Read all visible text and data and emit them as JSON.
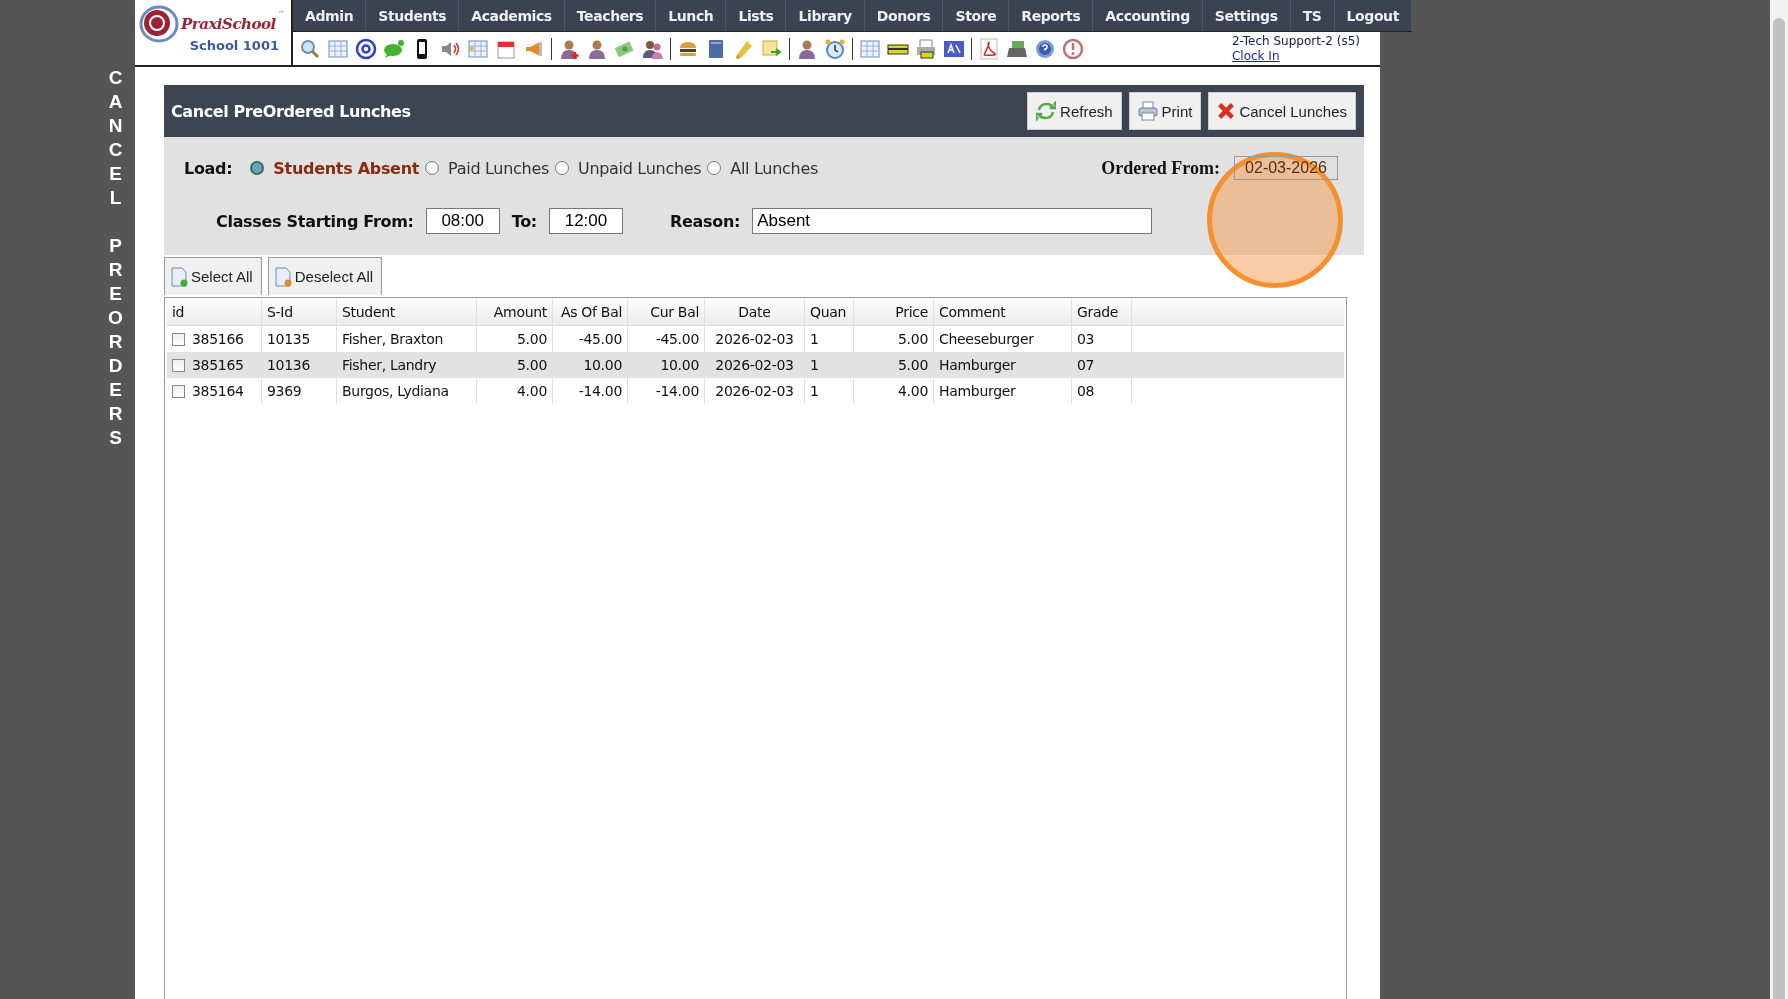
{
  "side_title": "CANCEL PREORDERS",
  "logo": {
    "brand": "PraxiSchool",
    "trademark": "™",
    "school": "School 1001"
  },
  "nav": [
    "Admin",
    "Students",
    "Academics",
    "Teachers",
    "Lunch",
    "Lists",
    "Library",
    "Donors",
    "Store",
    "Reports",
    "Accounting",
    "Settings",
    "TS",
    "Logout"
  ],
  "user": {
    "name": "2-Tech Support-2 (s5)",
    "link": "Clock In"
  },
  "panel": {
    "title": "Cancel PreOrdered Lunches",
    "buttons": [
      {
        "label": "Refresh",
        "kind": "refresh"
      },
      {
        "label": "Print",
        "kind": "print"
      },
      {
        "label": "Cancel Lunches",
        "kind": "cancel"
      }
    ]
  },
  "load": {
    "label": "Load:",
    "options": [
      {
        "label": "Students Absent",
        "selected": true
      },
      {
        "label": "Paid Lunches",
        "selected": false
      },
      {
        "label": "Unpaid Lunches",
        "selected": false
      },
      {
        "label": "All Lunches",
        "selected": false
      }
    ]
  },
  "ordered_from": {
    "label": "Ordered From:",
    "value": "02-03-2026"
  },
  "classes_from": {
    "label": "Classes Starting From:",
    "value": "08:00"
  },
  "classes_to": {
    "label": "To:",
    "value": "12:00"
  },
  "reason": {
    "label": "Reason:",
    "value": "Absent"
  },
  "list_buttons": [
    {
      "label": "Select All",
      "kind": "select"
    },
    {
      "label": "Deselect All",
      "kind": "deselect"
    }
  ],
  "table": {
    "columns": [
      "id",
      "S-Id",
      "Student",
      "Amount",
      "As Of Bal",
      "Cur Bal",
      "Date",
      "Quan",
      "Price",
      "Comment",
      "Grade"
    ],
    "rows": [
      {
        "checked": false,
        "selected": false,
        "cells": [
          "385166",
          "10135",
          "Fisher, Braxton",
          "5.00",
          "-45.00",
          "-45.00",
          "2026-02-03",
          "1",
          "5.00",
          "Cheeseburger",
          "03"
        ]
      },
      {
        "checked": false,
        "selected": true,
        "cells": [
          "385165",
          "10136",
          "Fisher, Landry",
          "5.00",
          "10.00",
          "10.00",
          "2026-02-03",
          "1",
          "5.00",
          "Hamburger",
          "07"
        ]
      },
      {
        "checked": false,
        "selected": false,
        "cells": [
          "385164",
          "9369",
          "Burgos, Lydiana",
          "4.00",
          "-14.00",
          "-14.00",
          "2026-02-03",
          "1",
          "4.00",
          "Hamburger",
          "08"
        ]
      }
    ]
  }
}
